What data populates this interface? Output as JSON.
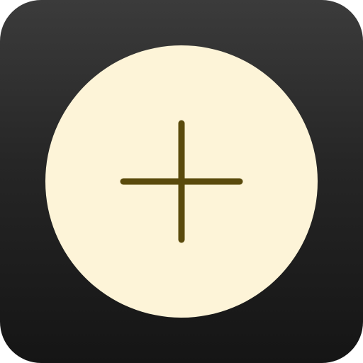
{
  "app_icon": {
    "icon": "plus-icon",
    "background_colors": [
      "#3b3b3b",
      "#151515"
    ],
    "button_color": "#fdf4d8",
    "glyph_color": "#5a4a0c"
  }
}
